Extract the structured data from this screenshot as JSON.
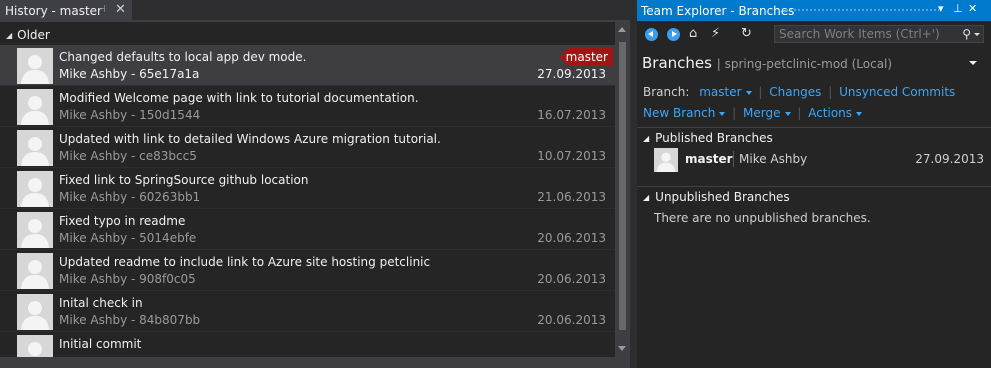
{
  "history": {
    "tab_title": "History - master",
    "pin_glyph": "⊣",
    "close_glyph": "✕",
    "group_label": "Older",
    "commits": [
      {
        "message": "Changed defaults to local app dev mode.",
        "meta": "Mike Ashby - 65e17a1a",
        "date": "27.09.2013",
        "badge": "master",
        "selected": true
      },
      {
        "message": "Modified Welcome page with link to tutorial documentation.",
        "meta": "Mike Ashby - 150d1544",
        "date": "16.07.2013"
      },
      {
        "message": "Updated with link to detailed Windows Azure migration tutorial.",
        "meta": "Mike Ashby - ce83bcc5",
        "date": "10.07.2013"
      },
      {
        "message": "Fixed link to SpringSource github location",
        "meta": "Mike Ashby - 60263bb1",
        "date": "21.06.2013"
      },
      {
        "message": "Fixed typo in readme",
        "meta": "Mike Ashby - 5014ebfe",
        "date": "20.06.2013"
      },
      {
        "message": "Updated readme to include link to Azure site hosting petclinic",
        "meta": "Mike Ashby - 908f0c05",
        "date": "20.06.2013"
      },
      {
        "message": "Inital check in",
        "meta": "Mike Ashby - 84b807bb",
        "date": "20.06.2013"
      },
      {
        "message": "Initial commit",
        "meta": "",
        "date": ""
      }
    ]
  },
  "team_explorer": {
    "title": "Team Explorer - Branches",
    "title_buttons": {
      "dropdown": "▾",
      "pin": "⊥",
      "close": "✕"
    },
    "toolbar": {
      "home_glyph": "⌂",
      "plug_glyph": "⚡",
      "refresh_glyph": "↻"
    },
    "search": {
      "placeholder": "Search Work Items (Ctrl+')",
      "icon_glyph": "⚲"
    },
    "header": {
      "title": "Branches",
      "subtitle": "spring-petclinic-mod (Local)"
    },
    "branch_label": "Branch:",
    "current_branch": "master",
    "links": {
      "changes": "Changes",
      "unsynced": "Unsynced Commits"
    },
    "actions": {
      "new_branch": "New Branch",
      "merge": "Merge",
      "actions": "Actions"
    },
    "published": {
      "label": "Published Branches",
      "branches": [
        {
          "name": "master",
          "author": "Mike Ashby",
          "date": "27.09.2013"
        }
      ]
    },
    "unpublished": {
      "label": "Unpublished Branches",
      "empty_text": "There are no unpublished branches."
    }
  },
  "colors": {
    "accent": "#007acc",
    "badge": "#a31515",
    "link": "#3ea5f5",
    "background": "#252526"
  }
}
